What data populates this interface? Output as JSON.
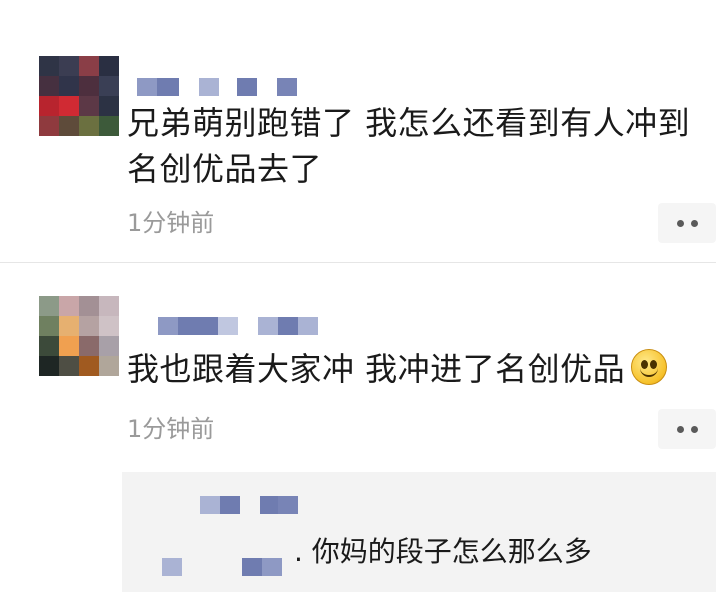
{
  "comments": [
    {
      "text_line1": "兄弟萌别跑错了 我怎么还看到有人冲到",
      "text_line2": "名创优品去了",
      "time": "1分钟前"
    },
    {
      "text": "我也跟着大家冲 我冲进了名创优品",
      "emoji_icon": "smiley-emoji",
      "time": "1分钟前"
    }
  ],
  "reply": {
    "text": ". 你妈的段子怎么那么多"
  },
  "colors": {
    "time_gray": "#9a9a9a",
    "reply_background": "#f3f3f3",
    "pixelated_name": "#6b78a8"
  }
}
